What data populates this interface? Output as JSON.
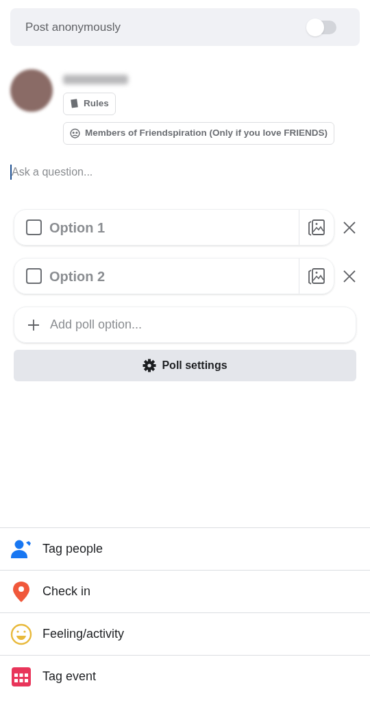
{
  "anonymous": {
    "label": "Post anonymously",
    "on": false
  },
  "author": {
    "chips": [
      {
        "kind": "rules",
        "label": "Rules"
      },
      {
        "kind": "group",
        "label": "Members of Friendspiration (Only if you love FRIENDS)"
      }
    ]
  },
  "question": {
    "placeholder": "Ask a question..."
  },
  "options": [
    {
      "placeholder": "Option 1",
      "checked": false
    },
    {
      "placeholder": "Option 2",
      "checked": false
    }
  ],
  "add_option": {
    "placeholder": "Add poll option..."
  },
  "poll_settings": {
    "label": "Poll settings"
  },
  "actions": [
    {
      "kind": "tag-people",
      "label": "Tag people"
    },
    {
      "kind": "check-in",
      "label": "Check in"
    },
    {
      "kind": "feeling",
      "label": "Feeling/activity"
    },
    {
      "kind": "event",
      "label": "Tag event"
    }
  ]
}
